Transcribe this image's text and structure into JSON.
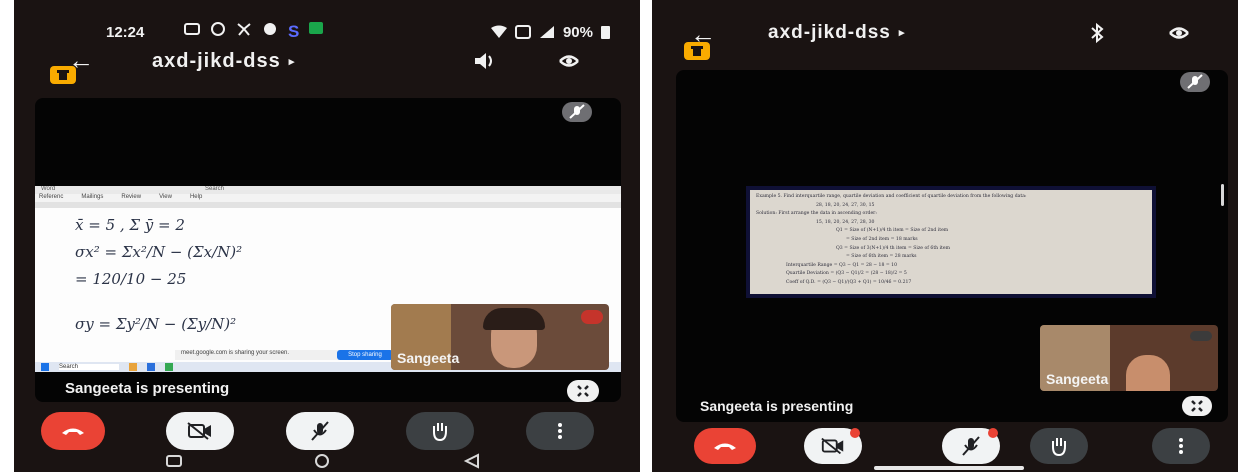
{
  "left": {
    "status_bar": {
      "time": "12:24",
      "battery": "90%"
    },
    "meeting_code": "axd-jikd-dss",
    "presenter_name": "Sangeeta",
    "presenting_text": "Sangeeta is presenting",
    "shared_screen": {
      "app_title": "Word",
      "search_placeholder": "Search",
      "ribbon_tabs": [
        "Referenc",
        "Mailings",
        "Review",
        "View",
        "Help"
      ],
      "sharing_notice": "meet.google.com is sharing your screen.",
      "stop_sharing": "Stop sharing",
      "taskbar_search": "Search",
      "math_lines": [
        "x̄ = 5 ,   Σ ȳ = 2",
        "σx² = Σx²/N − (Σx/N)²",
        "= 120/10 − 25",
        "σy = Σy²/N − (Σy/N)²"
      ]
    }
  },
  "right": {
    "meeting_code": "axd-jikd-dss",
    "presenter_name": "Sangeeta",
    "presenting_text": "Sangeeta is presenting",
    "document_lines": [
      "Example 5. Find interquartile range, quartile deviation and coefficient of quartile deviation from the following data:",
      "28, 18, 20, 24, 27, 30, 15",
      "Solution: First arrange the data in ascending order:",
      "15, 18, 20, 24, 27, 28, 30",
      "Q1 = Size of (N+1)/4 th item = Size of 2nd item",
      "= Size of 2nd item = 18 marks",
      "Q3 = Size of 3(N+1)/4 th item = Size of 6th item",
      "= Size of 6th item = 28 marks",
      "Interquartile Range = Q3 − Q1 = 28 − 18 = 10",
      "Quartile Deviation = (Q3 − Q1)/2 = (28 − 18)/2 = 5",
      "Coeff of Q.D. = (Q3 − Q1)/(Q3 + Q1) = 10/46 = 0.217"
    ]
  },
  "colors": {
    "accent_chip": "#f9ab00",
    "end_call": "#ea4335",
    "background": "#1a1312"
  }
}
